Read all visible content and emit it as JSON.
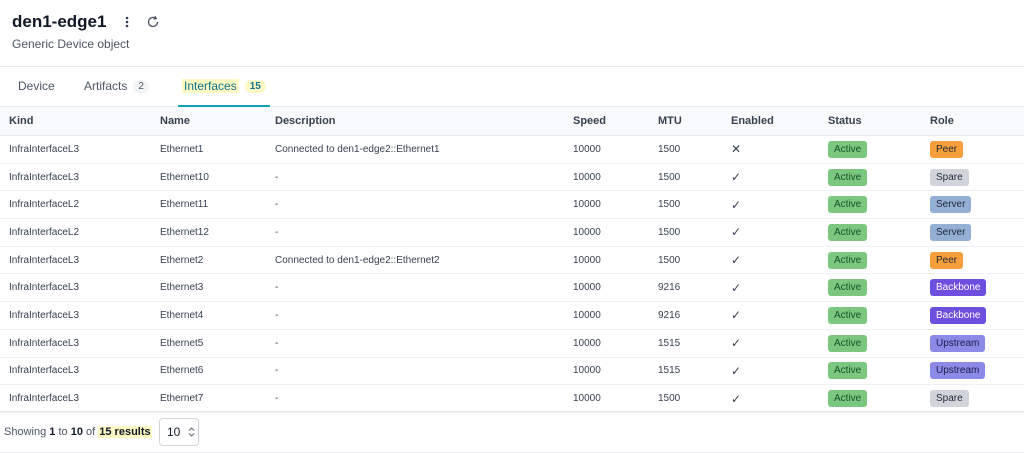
{
  "header": {
    "title": "den1-edge1",
    "subtitle": "Generic Device object",
    "menu_icon": "kebab-icon",
    "refresh_icon": "refresh-icon"
  },
  "tabs": [
    {
      "label": "Device",
      "count": ""
    },
    {
      "label": "Artifacts",
      "count": "2"
    },
    {
      "label": "Interfaces",
      "count": "15",
      "active": true
    }
  ],
  "table": {
    "columns": [
      "Kind",
      "Name",
      "Description",
      "Speed",
      "MTU",
      "Enabled",
      "Status",
      "Role"
    ],
    "rows": [
      {
        "kind": "InfraInterfaceL3",
        "name": "Ethernet1",
        "description": "Connected to den1-edge2::Ethernet1",
        "speed": "10000",
        "mtu": "1500",
        "enabled": "✕",
        "status": "Active",
        "role": "Peer"
      },
      {
        "kind": "InfraInterfaceL3",
        "name": "Ethernet10",
        "description": "-",
        "speed": "10000",
        "mtu": "1500",
        "enabled": "✓",
        "status": "Active",
        "role": "Spare"
      },
      {
        "kind": "InfraInterfaceL2",
        "name": "Ethernet11",
        "description": "-",
        "speed": "10000",
        "mtu": "1500",
        "enabled": "✓",
        "status": "Active",
        "role": "Server"
      },
      {
        "kind": "InfraInterfaceL2",
        "name": "Ethernet12",
        "description": "-",
        "speed": "10000",
        "mtu": "1500",
        "enabled": "✓",
        "status": "Active",
        "role": "Server"
      },
      {
        "kind": "InfraInterfaceL3",
        "name": "Ethernet2",
        "description": "Connected to den1-edge2::Ethernet2",
        "speed": "10000",
        "mtu": "1500",
        "enabled": "✓",
        "status": "Active",
        "role": "Peer"
      },
      {
        "kind": "InfraInterfaceL3",
        "name": "Ethernet3",
        "description": "-",
        "speed": "10000",
        "mtu": "9216",
        "enabled": "✓",
        "status": "Active",
        "role": "Backbone"
      },
      {
        "kind": "InfraInterfaceL3",
        "name": "Ethernet4",
        "description": "-",
        "speed": "10000",
        "mtu": "9216",
        "enabled": "✓",
        "status": "Active",
        "role": "Backbone"
      },
      {
        "kind": "InfraInterfaceL3",
        "name": "Ethernet5",
        "description": "-",
        "speed": "10000",
        "mtu": "1515",
        "enabled": "✓",
        "status": "Active",
        "role": "Upstream"
      },
      {
        "kind": "InfraInterfaceL3",
        "name": "Ethernet6",
        "description": "-",
        "speed": "10000",
        "mtu": "1515",
        "enabled": "✓",
        "status": "Active",
        "role": "Upstream"
      },
      {
        "kind": "InfraInterfaceL3",
        "name": "Ethernet7",
        "description": "-",
        "speed": "10000",
        "mtu": "1500",
        "enabled": "✓",
        "status": "Active",
        "role": "Spare"
      }
    ]
  },
  "role_colors": {
    "Peer": "#f59e3b",
    "Spare": "#d1d5db",
    "Server": "#93afd3",
    "Backbone": "#6d4fe0",
    "Upstream": "#8b8ae6"
  },
  "footer": {
    "prefix": "Showing",
    "from": "1",
    "to_word": "to",
    "to": "10",
    "of_word": "of",
    "total": "15 results",
    "page_size": "10"
  }
}
